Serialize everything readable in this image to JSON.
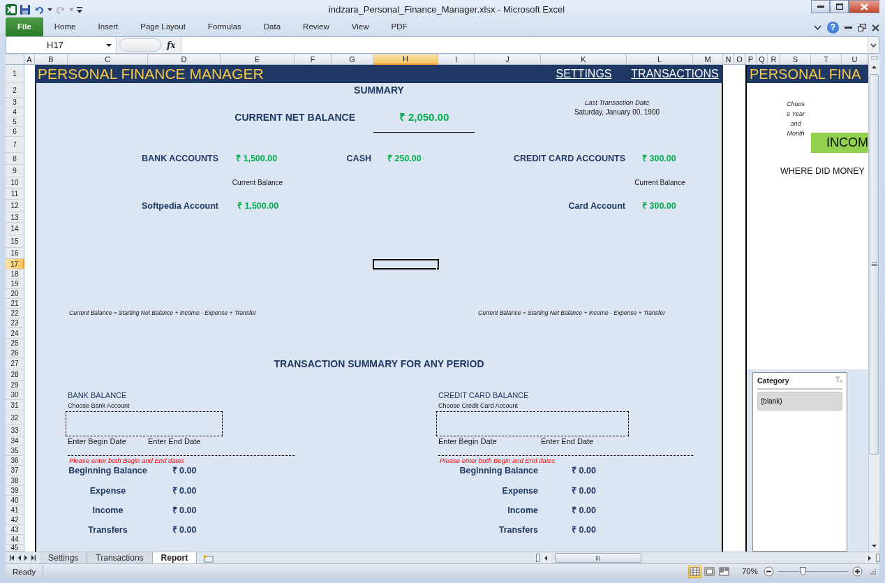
{
  "window": {
    "title": "indzara_Personal_Finance_Manager.xlsx  -  Microsoft Excel"
  },
  "ribbon_tabs": [
    {
      "label": "File",
      "selected": true
    },
    {
      "label": "Home",
      "selected": false
    },
    {
      "label": "Insert",
      "selected": false
    },
    {
      "label": "Page Layout",
      "selected": false
    },
    {
      "label": "Formulas",
      "selected": false
    },
    {
      "label": "Data",
      "selected": false
    },
    {
      "label": "Review",
      "selected": false
    },
    {
      "label": "View",
      "selected": false
    },
    {
      "label": "PDF",
      "selected": false
    }
  ],
  "help_button": {
    "label": "?"
  },
  "name_box": {
    "value": "H17"
  },
  "formula_bar": {
    "function_label": "fx"
  },
  "column_headers": [
    {
      "label": "A",
      "selected": false
    },
    {
      "label": "B",
      "selected": false
    },
    {
      "label": "C",
      "selected": false
    },
    {
      "label": "D",
      "selected": false
    },
    {
      "label": "E",
      "selected": false
    },
    {
      "label": "F",
      "selected": false
    },
    {
      "label": "G",
      "selected": false
    },
    {
      "label": "H",
      "selected": true
    },
    {
      "label": "I",
      "selected": false
    },
    {
      "label": "J",
      "selected": false
    },
    {
      "label": "K",
      "selected": false
    },
    {
      "label": "L",
      "selected": false
    },
    {
      "label": "M",
      "selected": false
    },
    {
      "label": "N",
      "selected": false
    },
    {
      "label": "O",
      "selected": false
    },
    {
      "label": "P",
      "selected": false
    },
    {
      "label": "Q",
      "selected": false
    },
    {
      "label": "R",
      "selected": false
    },
    {
      "label": "S",
      "selected": false
    },
    {
      "label": "T",
      "selected": false
    },
    {
      "label": "U",
      "selected": false
    }
  ],
  "row_headers": [
    {
      "label": "1",
      "selected": false
    },
    {
      "label": "2",
      "selected": false
    },
    {
      "label": "3",
      "selected": false
    },
    {
      "label": "4",
      "selected": false
    },
    {
      "label": "5",
      "selected": false
    },
    {
      "label": "6",
      "selected": false
    },
    {
      "label": "7",
      "selected": false
    },
    {
      "label": "8",
      "selected": false
    },
    {
      "label": "9",
      "selected": false
    },
    {
      "label": "10",
      "selected": false
    },
    {
      "label": "11",
      "selected": false
    },
    {
      "label": "12",
      "selected": false
    },
    {
      "label": "13",
      "selected": false
    },
    {
      "label": "14",
      "selected": false
    },
    {
      "label": "15",
      "selected": false
    },
    {
      "label": "16",
      "selected": false
    },
    {
      "label": "17",
      "selected": true
    },
    {
      "label": "18",
      "selected": false
    },
    {
      "label": "19",
      "selected": false
    },
    {
      "label": "20",
      "selected": false
    },
    {
      "label": "21",
      "selected": false
    },
    {
      "label": "22",
      "selected": false
    },
    {
      "label": "23",
      "selected": false
    },
    {
      "label": "24",
      "selected": false
    },
    {
      "label": "25",
      "selected": false
    },
    {
      "label": "26",
      "selected": false
    },
    {
      "label": "27",
      "selected": false
    },
    {
      "label": "28",
      "selected": false
    },
    {
      "label": "29",
      "selected": false
    },
    {
      "label": "30",
      "selected": false
    },
    {
      "label": "31",
      "selected": false
    },
    {
      "label": "32",
      "selected": false
    },
    {
      "label": "33",
      "selected": false
    },
    {
      "label": "34",
      "selected": false
    },
    {
      "label": "35",
      "selected": false
    },
    {
      "label": "36",
      "selected": false
    },
    {
      "label": "37",
      "selected": false
    },
    {
      "label": "38",
      "selected": false
    },
    {
      "label": "39",
      "selected": false
    },
    {
      "label": "40",
      "selected": false
    },
    {
      "label": "41",
      "selected": false
    },
    {
      "label": "42",
      "selected": false
    },
    {
      "label": "43",
      "selected": false
    },
    {
      "label": "44",
      "selected": false
    },
    {
      "label": "45",
      "selected": false
    }
  ],
  "report": {
    "header": {
      "title": "PERSONAL FINANCE MANAGER",
      "links": [
        "SETTINGS",
        "TRANSACTIONS"
      ]
    },
    "summary_title": "SUMMARY",
    "net_balance": {
      "label": "CURRENT NET BALANCE",
      "value": "₹ 2,050.00"
    },
    "last_transaction": {
      "label": "Last Transaction Date",
      "value": "Saturday, January 00, 1900"
    },
    "totals": [
      {
        "label": "BANK ACCOUNTS",
        "value": "₹ 1,500.00"
      },
      {
        "label": "CASH",
        "value": "₹ 250.00"
      },
      {
        "label": "CREDIT CARD ACCOUNTS",
        "value": "₹ 300.00"
      }
    ],
    "account_groups": [
      {
        "column_heading": "Current Balance",
        "accounts": [
          {
            "name": "Softpedia Account",
            "balance": "₹ 1,500.00"
          }
        ],
        "formula_note": "Current Balance = Starting Net Balance + Income - Expense + Transfer"
      },
      {
        "column_heading": "Current Balance",
        "accounts": [
          {
            "name": "Card Account",
            "balance": "₹ 300.00"
          }
        ],
        "formula_note": "Current Balance = Starting Net Balance + Income - Expense + Transfer"
      }
    ],
    "period_title": "TRANSACTION SUMMARY FOR ANY PERIOD",
    "period_panels": [
      {
        "title": "BANK BALANCE",
        "chooser_label": "Choose Bank Account",
        "begin_label": "Enter Begin Date",
        "end_label": "Enter End Date",
        "warning": "Please enter both Begin and End dates",
        "rows": [
          {
            "label": "Beginning Balance",
            "value": "₹ 0.00"
          },
          {
            "label": "Expense",
            "value": "₹ 0.00"
          },
          {
            "label": "Income",
            "value": "₹ 0.00"
          },
          {
            "label": "Transfers",
            "value": "₹ 0.00"
          }
        ]
      },
      {
        "title": "CREDIT CARD BALANCE",
        "chooser_label": "Choose Credit Card Account",
        "begin_label": "Enter Begin Date",
        "end_label": "Enter End Date",
        "warning": "Please enter both Begin and End dates",
        "rows": [
          {
            "label": "Beginning Balance",
            "value": "₹ 0.00"
          },
          {
            "label": "Expense",
            "value": "₹ 0.00"
          },
          {
            "label": "Income",
            "value": "₹ 0.00"
          },
          {
            "label": "Transfers",
            "value": "₹ 0.00"
          }
        ]
      }
    ]
  },
  "side_report": {
    "title": "PERSONAL FINA",
    "period_chooser_label": "Choos\ne Year\nand\nMonth",
    "income_button": "INCOM",
    "question": "WHERE DID MONEY",
    "slicer": {
      "title": "Category",
      "items": [
        "(blank)"
      ]
    }
  },
  "sheet_tabs": [
    {
      "label": "Settings",
      "selected": false
    },
    {
      "label": "Transactions",
      "selected": false
    },
    {
      "label": "Report",
      "selected": true
    }
  ],
  "status_bar": {
    "text": "Ready",
    "views": [
      {
        "kind": "normal",
        "selected": true
      },
      {
        "kind": "page_layout",
        "selected": false
      },
      {
        "kind": "page_break",
        "selected": false
      }
    ],
    "zoom": "70%",
    "zoom_slider": {
      "level": 0.35
    }
  }
}
